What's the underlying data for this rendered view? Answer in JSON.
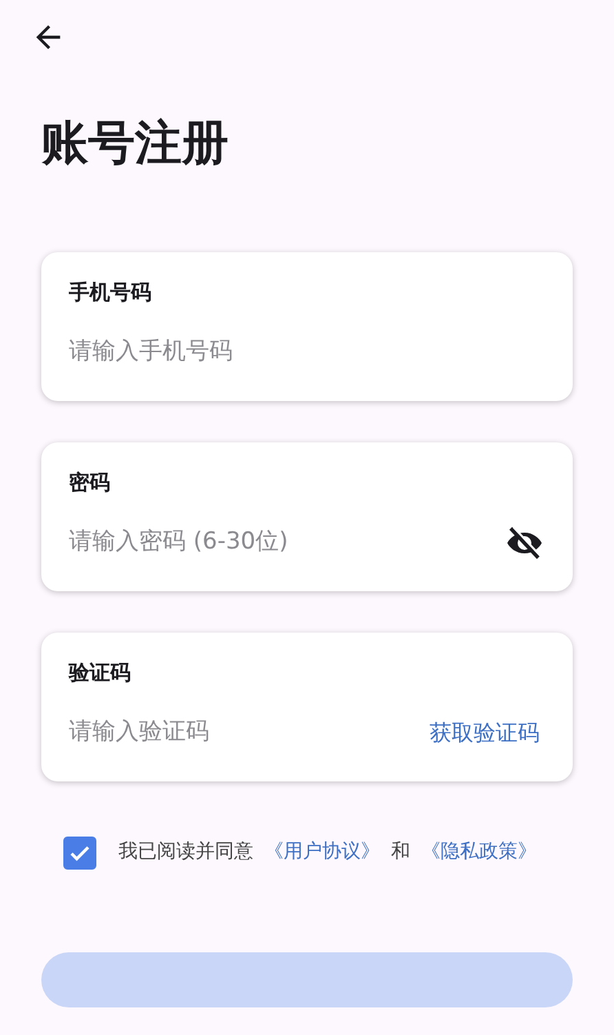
{
  "title": "账号注册",
  "fields": [
    {
      "label": "手机号码",
      "placeholder": "请输入手机号码",
      "kind": "plain"
    },
    {
      "label": "密码",
      "placeholder": "请输入密码 (6-30位)",
      "kind": "password",
      "visible": false
    },
    {
      "label": "验证码",
      "placeholder": "请输入验证码",
      "kind": "code",
      "action": "获取验证码"
    }
  ],
  "agreement": {
    "checked": true,
    "parts": [
      {
        "kind": "text",
        "text": "我已阅读并同意"
      },
      {
        "kind": "link",
        "text": "《用户协议》"
      },
      {
        "kind": "text",
        "text": "和"
      },
      {
        "kind": "link",
        "text": "《隐私政策》"
      }
    ]
  },
  "submit_button": {
    "disabled": true
  }
}
